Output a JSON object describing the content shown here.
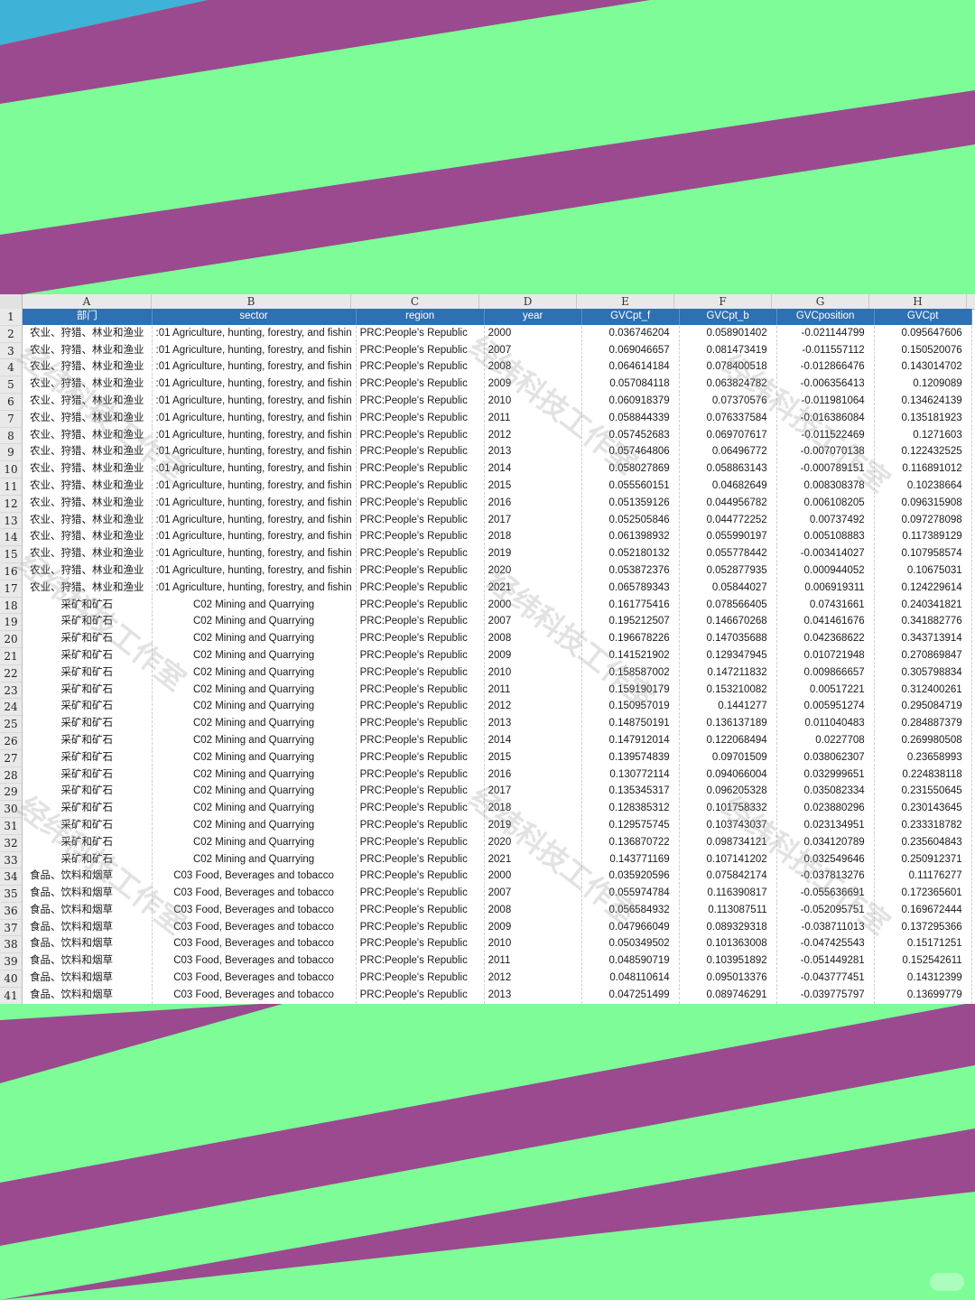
{
  "colors": {
    "stripe_purple": "#9b4a8f",
    "stripe_green": "#7efc98",
    "corner_blue": "#3fb2d8",
    "header_fill": "#2f6fb3"
  },
  "sheet": {
    "column_letters": [
      "A",
      "B",
      "C",
      "D",
      "E",
      "F",
      "G",
      "H"
    ],
    "headers": [
      "部门",
      "sector",
      "region",
      "year",
      "GVCpt_f",
      "GVCpt_b",
      "GVCposition",
      "GVCpt"
    ],
    "rows": [
      [
        "农业、狩猎、林业和渔业",
        ":01 Agriculture, hunting, forestry, and fishin",
        "PRC:People's Republic",
        "2000",
        "0.036746204",
        "0.058901402",
        "-0.021144799",
        "0.095647606"
      ],
      [
        "农业、狩猎、林业和渔业",
        ":01 Agriculture, hunting, forestry, and fishin",
        "PRC:People's Republic",
        "2007",
        "0.069046657",
        "0.081473419",
        "-0.011557112",
        "0.150520076"
      ],
      [
        "农业、狩猎、林业和渔业",
        ":01 Agriculture, hunting, forestry, and fishin",
        "PRC:People's Republic",
        "2008",
        "0.064614184",
        "0.078400518",
        "-0.012866476",
        "0.143014702"
      ],
      [
        "农业、狩猎、林业和渔业",
        ":01 Agriculture, hunting, forestry, and fishin",
        "PRC:People's Republic",
        "2009",
        "0.057084118",
        "0.063824782",
        "-0.006356413",
        "0.1209089"
      ],
      [
        "农业、狩猎、林业和渔业",
        ":01 Agriculture, hunting, forestry, and fishin",
        "PRC:People's Republic",
        "2010",
        "0.060918379",
        "0.07370576",
        "-0.011981064",
        "0.134624139"
      ],
      [
        "农业、狩猎、林业和渔业",
        ":01 Agriculture, hunting, forestry, and fishin",
        "PRC:People's Republic",
        "2011",
        "0.058844339",
        "0.076337584",
        "-0.016386084",
        "0.135181923"
      ],
      [
        "农业、狩猎、林业和渔业",
        ":01 Agriculture, hunting, forestry, and fishin",
        "PRC:People's Republic",
        "2012",
        "0.057452683",
        "0.069707617",
        "-0.011522469",
        "0.1271603"
      ],
      [
        "农业、狩猎、林业和渔业",
        ":01 Agriculture, hunting, forestry, and fishin",
        "PRC:People's Republic",
        "2013",
        "0.057464806",
        "0.06496772",
        "-0.007070138",
        "0.122432525"
      ],
      [
        "农业、狩猎、林业和渔业",
        ":01 Agriculture, hunting, forestry, and fishin",
        "PRC:People's Republic",
        "2014",
        "0.058027869",
        "0.058863143",
        "-0.000789151",
        "0.116891012"
      ],
      [
        "农业、狩猎、林业和渔业",
        ":01 Agriculture, hunting, forestry, and fishin",
        "PRC:People's Republic",
        "2015",
        "0.055560151",
        "0.04682649",
        "0.008308378",
        "0.10238664"
      ],
      [
        "农业、狩猎、林业和渔业",
        ":01 Agriculture, hunting, forestry, and fishin",
        "PRC:People's Republic",
        "2016",
        "0.051359126",
        "0.044956782",
        "0.006108205",
        "0.096315908"
      ],
      [
        "农业、狩猎、林业和渔业",
        ":01 Agriculture, hunting, forestry, and fishin",
        "PRC:People's Republic",
        "2017",
        "0.052505846",
        "0.044772252",
        "0.00737492",
        "0.097278098"
      ],
      [
        "农业、狩猎、林业和渔业",
        ":01 Agriculture, hunting, forestry, and fishin",
        "PRC:People's Republic",
        "2018",
        "0.061398932",
        "0.055990197",
        "0.005108883",
        "0.117389129"
      ],
      [
        "农业、狩猎、林业和渔业",
        ":01 Agriculture, hunting, forestry, and fishin",
        "PRC:People's Republic",
        "2019",
        "0.052180132",
        "0.055778442",
        "-0.003414027",
        "0.107958574"
      ],
      [
        "农业、狩猎、林业和渔业",
        ":01 Agriculture, hunting, forestry, and fishin",
        "PRC:People's Republic",
        "2020",
        "0.053872376",
        "0.052877935",
        "0.000944052",
        "0.10675031"
      ],
      [
        "农业、狩猎、林业和渔业",
        ":01 Agriculture, hunting, forestry, and fishin",
        "PRC:People's Republic",
        "2021",
        "0.065789343",
        "0.05844027",
        "0.006919311",
        "0.124229614"
      ],
      [
        "采矿和矿石",
        "C02 Mining and Quarrying",
        "PRC:People's Republic",
        "2000",
        "0.161775416",
        "0.078566405",
        "0.07431661",
        "0.240341821"
      ],
      [
        "采矿和矿石",
        "C02 Mining and Quarrying",
        "PRC:People's Republic",
        "2007",
        "0.195212507",
        "0.146670268",
        "0.041461676",
        "0.341882776"
      ],
      [
        "采矿和矿石",
        "C02 Mining and Quarrying",
        "PRC:People's Republic",
        "2008",
        "0.196678226",
        "0.147035688",
        "0.042368622",
        "0.343713914"
      ],
      [
        "采矿和矿石",
        "C02 Mining and Quarrying",
        "PRC:People's Republic",
        "2009",
        "0.141521902",
        "0.129347945",
        "0.010721948",
        "0.270869847"
      ],
      [
        "采矿和矿石",
        "C02 Mining and Quarrying",
        "PRC:People's Republic",
        "2010",
        "0.158587002",
        "0.147211832",
        "0.009866657",
        "0.305798834"
      ],
      [
        "采矿和矿石",
        "C02 Mining and Quarrying",
        "PRC:People's Republic",
        "2011",
        "0.159190179",
        "0.153210082",
        "0.00517221",
        "0.312400261"
      ],
      [
        "采矿和矿石",
        "C02 Mining and Quarrying",
        "PRC:People's Republic",
        "2012",
        "0.150957019",
        "0.1441277",
        "0.005951274",
        "0.295084719"
      ],
      [
        "采矿和矿石",
        "C02 Mining and Quarrying",
        "PRC:People's Republic",
        "2013",
        "0.148750191",
        "0.136137189",
        "0.011040483",
        "0.284887379"
      ],
      [
        "采矿和矿石",
        "C02 Mining and Quarrying",
        "PRC:People's Republic",
        "2014",
        "0.147912014",
        "0.122068494",
        "0.0227708",
        "0.269980508"
      ],
      [
        "采矿和矿石",
        "C02 Mining and Quarrying",
        "PRC:People's Republic",
        "2015",
        "0.139574839",
        "0.09701509",
        "0.038062307",
        "0.23658993"
      ],
      [
        "采矿和矿石",
        "C02 Mining and Quarrying",
        "PRC:People's Republic",
        "2016",
        "0.130772114",
        "0.094066004",
        "0.032999651",
        "0.224838118"
      ],
      [
        "采矿和矿石",
        "C02 Mining and Quarrying",
        "PRC:People's Republic",
        "2017",
        "0.135345317",
        "0.096205328",
        "0.035082334",
        "0.231550645"
      ],
      [
        "采矿和矿石",
        "C02 Mining and Quarrying",
        "PRC:People's Republic",
        "2018",
        "0.128385312",
        "0.101758332",
        "0.023880296",
        "0.230143645"
      ],
      [
        "采矿和矿石",
        "C02 Mining and Quarrying",
        "PRC:People's Republic",
        "2019",
        "0.129575745",
        "0.103743037",
        "0.023134951",
        "0.233318782"
      ],
      [
        "采矿和矿石",
        "C02 Mining and Quarrying",
        "PRC:People's Republic",
        "2020",
        "0.136870722",
        "0.098734121",
        "0.034120789",
        "0.235604843"
      ],
      [
        "采矿和矿石",
        "C02 Mining and Quarrying",
        "PRC:People's Republic",
        "2021",
        "0.143771169",
        "0.107141202",
        "0.032549646",
        "0.250912371"
      ],
      [
        "食品、饮料和烟草",
        "C03 Food, Beverages and tobacco",
        "PRC:People's Republic",
        "2000",
        "0.035920596",
        "0.075842174",
        "-0.037813276",
        "0.11176277"
      ],
      [
        "食品、饮料和烟草",
        "C03 Food, Beverages and tobacco",
        "PRC:People's Republic",
        "2007",
        "0.055974784",
        "0.116390817",
        "-0.055636691",
        "0.172365601"
      ],
      [
        "食品、饮料和烟草",
        "C03 Food, Beverages and tobacco",
        "PRC:People's Republic",
        "2008",
        "0.056584932",
        "0.113087511",
        "-0.052095751",
        "0.169672444"
      ],
      [
        "食品、饮料和烟草",
        "C03 Food, Beverages and tobacco",
        "PRC:People's Republic",
        "2009",
        "0.047966049",
        "0.089329318",
        "-0.038711013",
        "0.137295366"
      ],
      [
        "食品、饮料和烟草",
        "C03 Food, Beverages and tobacco",
        "PRC:People's Republic",
        "2010",
        "0.050349502",
        "0.101363008",
        "-0.047425543",
        "0.15171251"
      ],
      [
        "食品、饮料和烟草",
        "C03 Food, Beverages and tobacco",
        "PRC:People's Republic",
        "2011",
        "0.048590719",
        "0.103951892",
        "-0.051449281",
        "0.152542611"
      ],
      [
        "食品、饮料和烟草",
        "C03 Food, Beverages and tobacco",
        "PRC:People's Republic",
        "2012",
        "0.048110614",
        "0.095013376",
        "-0.043777451",
        "0.14312399"
      ],
      [
        "食品、饮料和烟草",
        "C03 Food, Beverages and tobacco",
        "PRC:People's Republic",
        "2013",
        "0.047251499",
        "0.089746291",
        "-0.039775797",
        "0.13699779"
      ]
    ]
  },
  "watermark": "经纬科技工作室"
}
